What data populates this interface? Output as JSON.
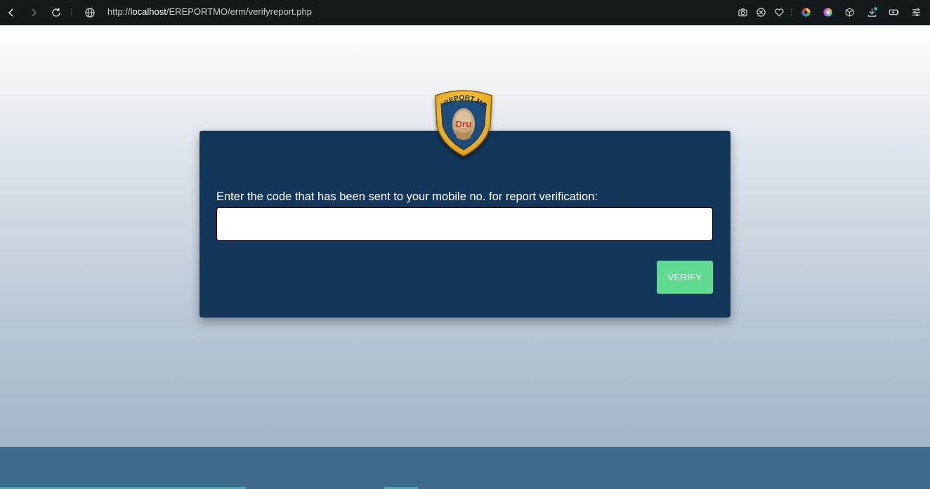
{
  "browser": {
    "url_prefix": "http://",
    "url_host": "localhost",
    "url_path": "/EREPORTMO/erm/verifyreport.php",
    "icons": [
      "back-icon",
      "forward-icon",
      "reload-icon",
      "globe-icon",
      "camera-icon",
      "close-circle-icon",
      "heart-icon",
      "color-wheel-icon",
      "palette-icon",
      "cube-icon",
      "download-icon",
      "battery-icon",
      "settings-sliders-icon"
    ]
  },
  "logo": {
    "text": "E-REPORT MO!",
    "inner_text": "Dru"
  },
  "form": {
    "label": "Enter the code that has been sent to your mobile no. for report verification:",
    "input_value": "",
    "input_placeholder": "",
    "verify_label": "VERIFY"
  },
  "colors": {
    "card": "#12375b",
    "button": "#5fdc8f",
    "footer": "#3e6a8e",
    "browser_bar": "#14191b"
  }
}
